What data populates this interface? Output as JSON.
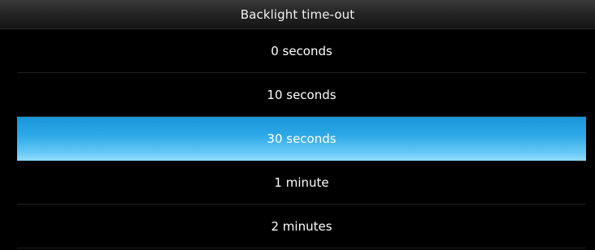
{
  "dialog": {
    "title": "Backlight time-out"
  },
  "options": [
    {
      "label": "0 seconds",
      "selected": false
    },
    {
      "label": "10 seconds",
      "selected": false
    },
    {
      "label": "30 seconds",
      "selected": true
    },
    {
      "label": "1 minute",
      "selected": false
    },
    {
      "label": "2 minutes",
      "selected": false
    }
  ],
  "colors": {
    "background": "#000000",
    "selection": "#2ba6e6",
    "text": "#ffffff"
  }
}
